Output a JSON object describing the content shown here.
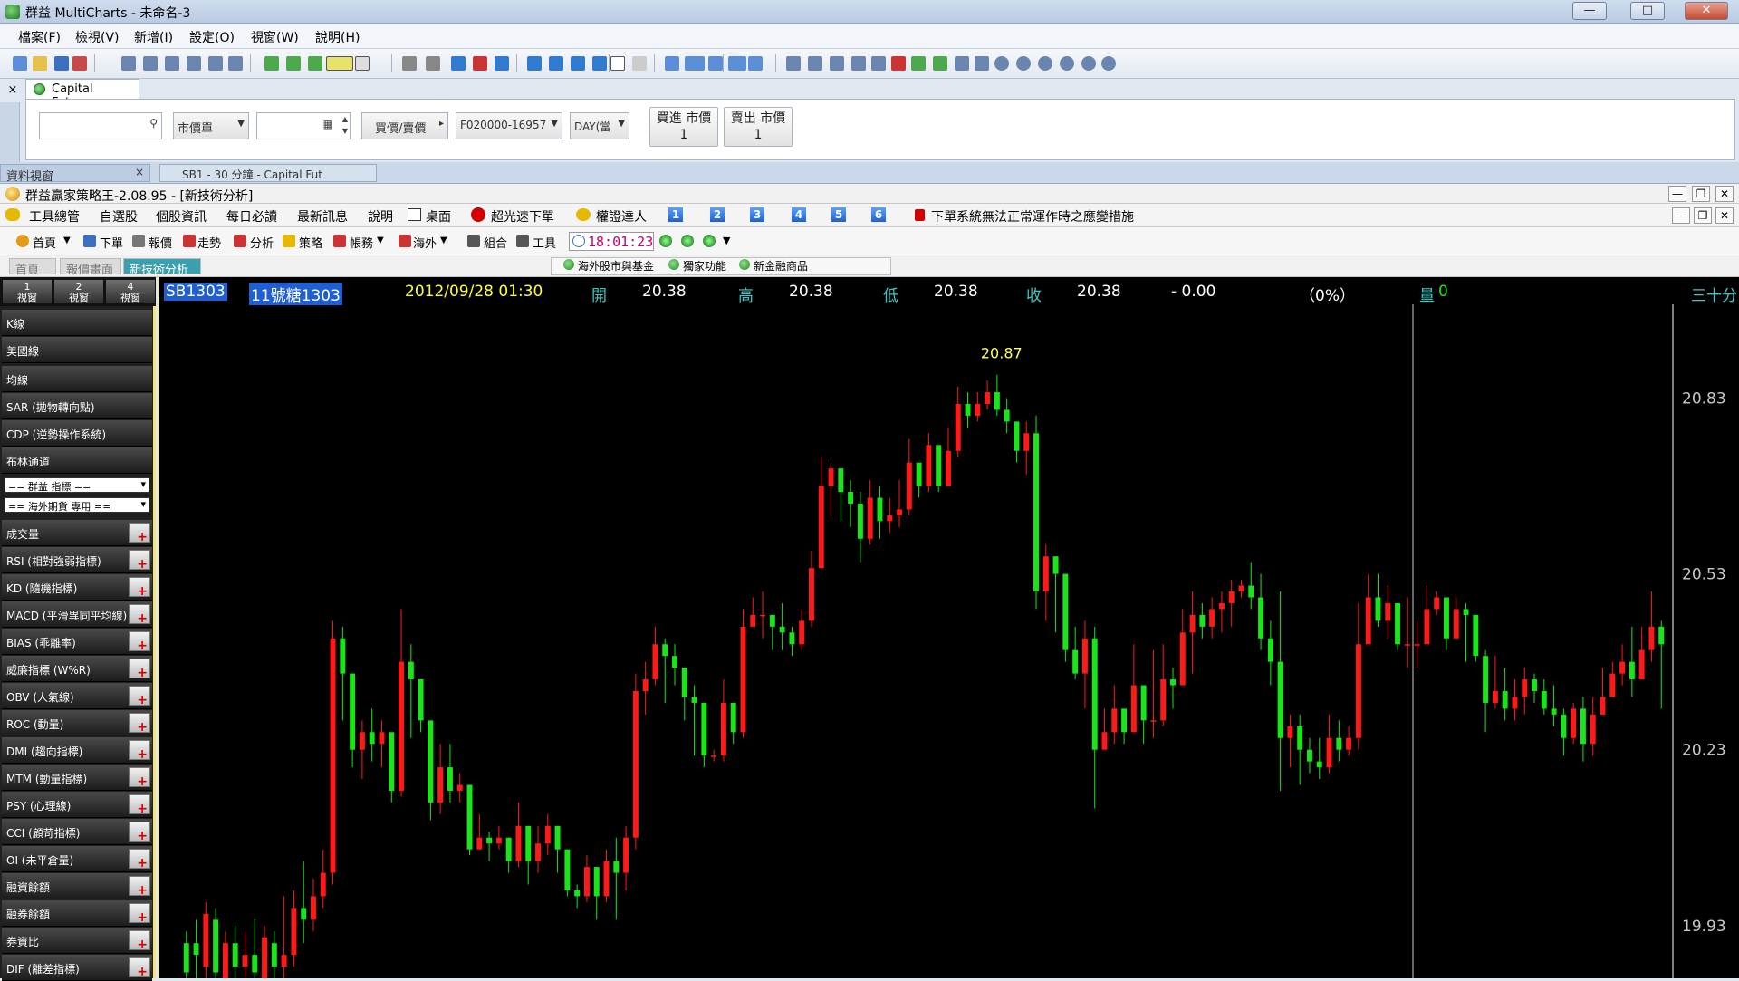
{
  "window": {
    "title": "群益 MultiCharts - 未命名-3",
    "buttons": [
      "—",
      "□",
      "✕"
    ]
  },
  "menubar": [
    "檔案(F)",
    "檢視(V)",
    "新增(I)",
    "設定(O)",
    "視窗(W)",
    "說明(H)"
  ],
  "order_panel": {
    "tab_label": "Capital Futures",
    "price_type": "市價單",
    "side_select": "買價/賣價",
    "account": "F020000-16957",
    "tif": "DAY(當",
    "buy_button": {
      "line1": "買進 市價",
      "line2": "1"
    },
    "sell_button": {
      "line1": "賣出 市價",
      "line2": "1"
    }
  },
  "inner_strip": {
    "data_tab": "資料視窗",
    "chart_tab": "SB1 - 30 分鐘 - Capital Fut"
  },
  "inner_window": {
    "title": "群益贏家策略王-2.08.95 - [新技術分析]"
  },
  "inner_menu": {
    "items": [
      "工具總管",
      "自選股",
      "個股資訊",
      "每日必讀",
      "最新訊息",
      "說明",
      "桌面",
      "超光速下單",
      "權證達人"
    ],
    "numbers": [
      "1",
      "2",
      "3",
      "4",
      "5",
      "6"
    ],
    "warning": "下單系統無法正常運作時之應變措施"
  },
  "inner_toolbar": {
    "items": [
      "首頁",
      "下單",
      "報價",
      "走勢",
      "分析",
      "策略",
      "帳務",
      "海外",
      "組合",
      "工具"
    ],
    "clock": "18:01:23"
  },
  "tab_row": {
    "tabs": [
      "首頁",
      "報價畫面",
      "新技術分析"
    ],
    "right_tabs": [
      "海外股市與基金",
      "獨家功能",
      "新金融商品"
    ]
  },
  "sidebar": {
    "views": [
      {
        "line1": "1",
        "line2": "視窗"
      },
      {
        "line1": "2",
        "line2": "視窗"
      },
      {
        "line1": "4",
        "line2": "視窗"
      }
    ],
    "top_items": [
      "K線",
      "美國線",
      "均線",
      "SAR (拋物轉向點)",
      "CDP (逆勢操作系統)",
      "布林通道"
    ],
    "dropdowns": [
      "== 群益 指標 ==",
      "== 海外期貨 專用 =="
    ],
    "indicators": [
      "成交量",
      "RSI (相對強弱指標)",
      "KD (隨機指標)",
      "MACD (平滑異同平均線)",
      "BIAS (乖離率)",
      "威廉指標 (W%R)",
      "OBV (人氣線)",
      "ROC (動量)",
      "DMI (趨向指標)",
      "MTM (動量指標)",
      "PSY (心理線)",
      "CCI (顧苛指標)",
      "OI (未平倉量)",
      "融資餘額",
      "融券餘額",
      "券資比",
      "DIF (離差指標)"
    ]
  },
  "quote": {
    "symbol": "SB1303",
    "name": "11號糖1303",
    "datetime": "2012/09/28 01:30",
    "open_label": "開",
    "open": "20.38",
    "high_label": "高",
    "high": "20.38",
    "low_label": "低",
    "low": "20.38",
    "close_label": "收",
    "close": "20.38",
    "change": "- 0.00",
    "pct": "（0%）",
    "vol_label": "量",
    "volume": "0",
    "period": "三十分"
  },
  "colors": {
    "up": "#ff1a1a",
    "down": "#19e619",
    "axis_text": "#c8c8c8",
    "max_label": "#ffff66"
  },
  "chart_data": {
    "type": "candlestick",
    "y_ticks": [
      "20.83",
      "20.53",
      "20.23",
      "19.93"
    ],
    "ylim": [
      19.84,
      20.99
    ],
    "max_label": "20.87",
    "candles": [
      [
        19.9,
        19.85,
        19.92,
        19.8
      ],
      [
        19.9,
        19.88,
        19.94,
        19.8
      ],
      [
        19.86,
        19.95,
        19.97,
        19.84
      ],
      [
        19.94,
        19.85,
        19.96,
        19.8
      ],
      [
        19.84,
        19.9,
        19.92,
        19.78
      ],
      [
        19.9,
        19.86,
        19.93,
        19.84
      ],
      [
        19.86,
        19.88,
        19.92,
        19.83
      ],
      [
        19.88,
        19.85,
        19.94,
        19.82
      ],
      [
        19.84,
        19.91,
        19.93,
        19.82
      ],
      [
        19.9,
        19.86,
        19.92,
        19.84
      ],
      [
        19.86,
        19.88,
        19.98,
        19.8
      ],
      [
        19.88,
        19.96,
        19.99,
        19.86
      ],
      [
        19.96,
        19.94,
        20.04,
        19.9
      ],
      [
        19.94,
        19.98,
        20.01,
        19.92
      ],
      [
        19.98,
        20.02,
        20.06,
        19.96
      ],
      [
        20.02,
        20.42,
        20.45,
        20.0
      ],
      [
        20.42,
        20.36,
        20.44,
        20.28
      ],
      [
        20.36,
        20.23,
        20.25,
        20.2
      ],
      [
        20.23,
        20.26,
        20.28,
        20.18
      ],
      [
        20.26,
        20.24,
        20.3,
        20.21
      ],
      [
        20.24,
        20.26,
        20.28,
        20.2
      ],
      [
        20.26,
        20.16,
        20.21,
        20.14
      ],
      [
        20.16,
        20.38,
        20.47,
        20.15
      ],
      [
        20.38,
        20.35,
        20.41,
        20.25
      ],
      [
        20.35,
        20.28,
        20.31,
        20.26
      ],
      [
        20.28,
        20.14,
        20.19,
        20.11
      ],
      [
        20.14,
        20.2,
        20.24,
        20.12
      ],
      [
        20.2,
        20.16,
        20.24,
        20.14
      ],
      [
        20.16,
        20.17,
        20.19,
        20.14
      ],
      [
        20.17,
        20.06,
        20.08,
        20.05
      ],
      [
        20.06,
        20.08,
        20.12,
        20.06
      ],
      [
        20.08,
        20.07,
        20.09,
        20.04
      ],
      [
        20.07,
        20.08,
        20.1,
        20.06
      ],
      [
        20.08,
        20.04,
        20.08,
        20.02
      ],
      [
        20.04,
        20.1,
        20.14,
        20.03
      ],
      [
        20.1,
        20.04,
        20.07,
        20.0
      ],
      [
        20.04,
        20.07,
        20.1,
        20.02
      ],
      [
        20.07,
        20.1,
        20.12,
        20.05
      ],
      [
        20.1,
        20.06,
        20.09,
        20.02
      ],
      [
        20.06,
        19.99,
        20.02,
        19.98
      ],
      [
        19.99,
        19.98,
        20.0,
        19.96
      ],
      [
        19.98,
        20.03,
        20.05,
        19.97
      ],
      [
        20.03,
        19.98,
        20.01,
        19.94
      ],
      [
        19.98,
        20.04,
        20.06,
        19.97
      ],
      [
        20.04,
        20.02,
        20.08,
        19.94
      ],
      [
        20.02,
        20.08,
        20.1,
        19.99
      ],
      [
        20.08,
        20.33,
        20.36,
        20.06
      ],
      [
        20.33,
        20.35,
        20.38,
        20.29
      ],
      [
        20.35,
        20.41,
        20.44,
        20.34
      ],
      [
        20.41,
        20.39,
        20.42,
        20.31
      ],
      [
        20.39,
        20.37,
        20.41,
        20.34
      ],
      [
        20.37,
        20.32,
        20.37,
        20.28
      ],
      [
        20.32,
        20.31,
        20.34,
        20.22
      ],
      [
        20.31,
        20.22,
        20.24,
        20.2
      ],
      [
        20.22,
        20.22,
        20.23,
        20.21
      ],
      [
        20.22,
        20.31,
        20.35,
        20.21
      ],
      [
        20.31,
        20.26,
        20.29,
        20.24
      ],
      [
        20.26,
        20.44,
        20.47,
        20.25
      ],
      [
        20.44,
        20.46,
        20.49,
        20.44
      ],
      [
        20.46,
        20.46,
        20.5,
        20.42
      ],
      [
        20.46,
        20.44,
        20.46,
        20.4
      ],
      [
        20.44,
        20.43,
        20.48,
        20.4
      ],
      [
        20.43,
        20.41,
        20.44,
        20.39
      ],
      [
        20.41,
        20.45,
        20.47,
        20.4
      ],
      [
        20.45,
        20.54,
        20.57,
        20.44
      ],
      [
        20.54,
        20.68,
        20.73,
        20.54
      ],
      [
        20.68,
        20.71,
        20.72,
        20.63
      ],
      [
        20.71,
        20.67,
        20.7,
        20.62
      ],
      [
        20.67,
        20.65,
        20.69,
        20.61
      ],
      [
        20.65,
        20.59,
        20.67,
        20.55
      ],
      [
        20.59,
        20.66,
        20.69,
        20.58
      ],
      [
        20.66,
        20.62,
        20.68,
        20.59
      ],
      [
        20.62,
        20.63,
        20.66,
        20.6
      ],
      [
        20.63,
        20.64,
        20.69,
        20.61
      ],
      [
        20.64,
        20.72,
        20.76,
        20.63
      ],
      [
        20.72,
        20.68,
        20.7,
        20.66
      ],
      [
        20.68,
        20.75,
        20.77,
        20.67
      ],
      [
        20.75,
        20.68,
        20.72,
        20.67
      ],
      [
        20.68,
        20.74,
        20.78,
        20.69
      ],
      [
        20.74,
        20.82,
        20.85,
        20.73
      ],
      [
        20.82,
        20.8,
        20.84,
        20.78
      ],
      [
        20.8,
        20.82,
        20.84,
        20.79
      ],
      [
        20.82,
        20.84,
        20.86,
        20.81
      ],
      [
        20.84,
        20.81,
        20.87,
        20.8
      ],
      [
        20.81,
        20.79,
        20.83,
        20.77
      ],
      [
        20.79,
        20.74,
        20.78,
        20.72
      ],
      [
        20.74,
        20.77,
        20.79,
        20.7
      ],
      [
        20.77,
        20.5,
        20.8,
        20.47
      ],
      [
        20.5,
        20.56,
        20.58,
        20.45
      ],
      [
        20.56,
        20.53,
        20.56,
        20.43
      ],
      [
        20.53,
        20.4,
        20.52,
        20.38
      ],
      [
        20.4,
        20.36,
        20.44,
        20.35
      ],
      [
        20.36,
        20.42,
        20.45,
        20.3
      ],
      [
        20.42,
        20.23,
        20.44,
        20.13
      ],
      [
        20.23,
        20.26,
        20.3,
        20.24
      ],
      [
        20.26,
        20.3,
        20.34,
        20.24
      ],
      [
        20.3,
        20.26,
        20.3,
        20.24
      ],
      [
        20.26,
        20.34,
        20.41,
        20.26
      ],
      [
        20.34,
        20.28,
        20.34,
        20.24
      ],
      [
        20.28,
        20.28,
        20.4,
        20.25
      ],
      [
        20.28,
        20.35,
        20.41,
        20.27
      ],
      [
        20.35,
        20.34,
        20.37,
        20.3
      ],
      [
        20.34,
        20.43,
        20.47,
        20.35
      ],
      [
        20.43,
        20.46,
        20.5,
        20.36
      ],
      [
        20.46,
        20.44,
        20.48,
        20.42
      ],
      [
        20.44,
        20.47,
        20.49,
        20.42
      ],
      [
        20.47,
        20.48,
        20.5,
        20.43
      ],
      [
        20.48,
        20.5,
        20.52,
        20.44
      ],
      [
        20.5,
        20.51,
        20.52,
        20.49
      ],
      [
        20.51,
        20.49,
        20.55,
        20.47
      ],
      [
        20.49,
        20.42,
        20.53,
        20.4
      ],
      [
        20.42,
        20.38,
        20.45,
        20.34
      ],
      [
        20.38,
        20.25,
        20.5,
        20.16
      ],
      [
        20.25,
        20.27,
        20.29,
        20.2
      ],
      [
        20.27,
        20.23,
        20.29,
        20.17
      ],
      [
        20.23,
        20.21,
        20.25,
        20.19
      ],
      [
        20.21,
        20.2,
        20.25,
        20.18
      ],
      [
        20.2,
        20.25,
        20.29,
        20.19
      ],
      [
        20.25,
        20.23,
        20.28,
        20.21
      ],
      [
        20.23,
        20.25,
        20.27,
        20.22
      ],
      [
        20.25,
        20.41,
        20.48,
        20.23
      ],
      [
        20.41,
        20.49,
        20.53,
        20.42
      ],
      [
        20.49,
        20.45,
        20.53,
        20.44
      ],
      [
        20.45,
        20.48,
        20.51,
        20.42
      ],
      [
        20.48,
        20.41,
        20.47,
        20.4
      ],
      [
        20.41,
        20.41,
        20.49,
        20.37
      ],
      [
        20.41,
        20.41,
        20.45,
        20.37
      ],
      [
        20.41,
        20.47,
        20.51,
        20.46
      ],
      [
        20.47,
        20.49,
        20.5,
        20.46
      ],
      [
        20.49,
        20.42,
        20.49,
        20.4
      ],
      [
        20.42,
        20.47,
        20.49,
        20.43
      ],
      [
        20.47,
        20.46,
        20.48,
        20.38
      ],
      [
        20.46,
        20.39,
        20.41,
        20.38
      ],
      [
        20.39,
        20.31,
        20.4,
        20.26
      ],
      [
        20.31,
        20.33,
        20.39,
        20.3
      ],
      [
        20.33,
        20.3,
        20.37,
        20.28
      ],
      [
        20.3,
        20.32,
        20.35,
        20.28
      ],
      [
        20.32,
        20.35,
        20.37,
        20.29
      ],
      [
        20.35,
        20.33,
        20.36,
        20.31
      ],
      [
        20.33,
        20.3,
        20.35,
        20.29
      ],
      [
        20.3,
        20.29,
        20.34,
        20.27
      ],
      [
        20.29,
        20.25,
        20.3,
        20.22
      ],
      [
        20.25,
        20.3,
        20.31,
        20.24
      ],
      [
        20.3,
        20.24,
        20.32,
        20.21
      ],
      [
        20.24,
        20.29,
        20.32,
        20.22
      ],
      [
        20.29,
        20.32,
        20.37,
        20.3
      ],
      [
        20.32,
        20.36,
        20.38,
        20.34
      ],
      [
        20.36,
        20.38,
        20.41,
        20.34
      ],
      [
        20.38,
        20.35,
        20.44,
        20.32
      ],
      [
        20.35,
        20.4,
        20.44,
        20.36
      ],
      [
        20.4,
        20.44,
        20.5,
        20.38
      ],
      [
        20.44,
        20.41,
        20.45,
        20.3
      ]
    ]
  }
}
